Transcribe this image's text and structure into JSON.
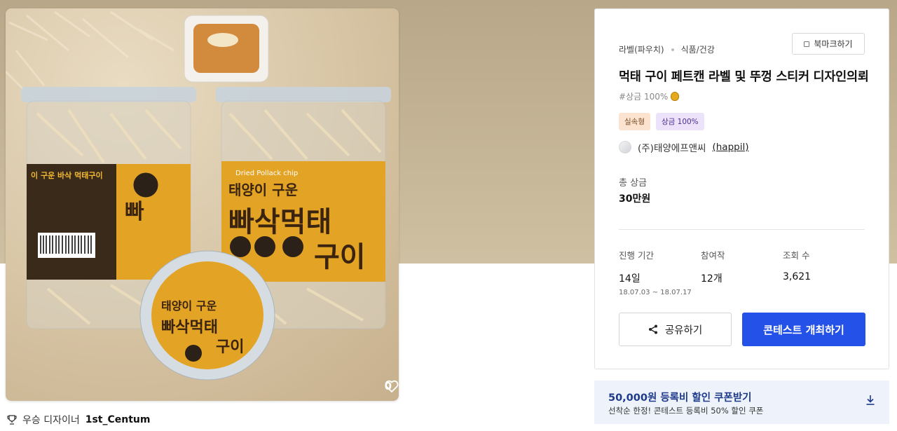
{
  "product": {
    "likes": "0",
    "winner_prefix": "우승 디자이너",
    "winner_name": "1st_Centum"
  },
  "card": {
    "category_1": "라벨(파우치)",
    "category_2": "식품/건강",
    "bookmark_label": "북마크하기",
    "title": "먹태 구이 페트캔 라벨 및 뚜껑 스티커 디자인의뢰",
    "prize_tag": "#상금 100%",
    "badges": [
      "실속형",
      "상금 100%"
    ],
    "company": "(주)태양에프앤씨",
    "company_handle": "(happil)",
    "total_prize_label": "총 상금",
    "total_prize_value": "30만원",
    "stats": {
      "period_label": "진행 기간",
      "period_value": "14일",
      "period_range": "18.07.03 ~ 18.07.17",
      "participants_label": "참여작",
      "participants_value": "12개",
      "views_label": "조회 수",
      "views_value": "3,621"
    },
    "share_label": "공유하기",
    "host_label": "콘테스트 개최하기"
  },
  "coupon": {
    "title": "50,000원 등록비 할인 쿠폰받기",
    "subtitle": "선착순 한정! 콘테스트 등록비 50% 할인 쿠폰"
  },
  "colors": {
    "accent": "#2452e8",
    "coupon_bg": "#eef3fb",
    "coupon_text": "#1e3a8a"
  }
}
